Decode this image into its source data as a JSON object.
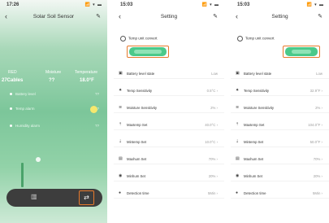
{
  "screen1": {
    "status_time": "17:26",
    "status_icons": "📶 ▾ ▬",
    "title": "Solar Soil Sensor",
    "back_icon": "‹",
    "edit_icon": "✎",
    "stats": [
      {
        "label": "RED",
        "value": "??"
      },
      {
        "label": "Moisture",
        "value": "??"
      },
      {
        "label": "Temperature",
        "value": "??"
      }
    ],
    "stat_main": "27Cables",
    "stat_mid": "??",
    "stat_right": "18.0°F",
    "features": [
      {
        "label": "Battery level",
        "value": "??"
      },
      {
        "label": "Temp alarm",
        "value": "??"
      },
      {
        "label": "Humidity alarm",
        "value": "??"
      }
    ],
    "dock": {
      "chart_icon": "▥",
      "settings_icon": "⇄"
    }
  },
  "screen2": {
    "status_time": "15:03",
    "status_icons": "📶 ▾ ▬",
    "title": "Setting",
    "back_icon": "‹",
    "edit_icon": "✎",
    "unit_label": "Temp unit convert",
    "rows": [
      {
        "icon": "▣",
        "label": "Battery level state",
        "value": "Low"
      },
      {
        "icon": "✷",
        "label": "Temp Sensitivity",
        "value": "0.5°C ›"
      },
      {
        "icon": "≋",
        "label": "Moisture Sensitivity",
        "value": "2% ›"
      },
      {
        "icon": "⇡",
        "label": "Maxtemp Set",
        "value": "40.0°C ›"
      },
      {
        "icon": "⇣",
        "label": "Mintemp Set",
        "value": "10.0°C ›"
      },
      {
        "icon": "▤",
        "label": "Maxhum Set",
        "value": "70% ›"
      },
      {
        "icon": "◉",
        "label": "Minhum Set",
        "value": "20% ›"
      },
      {
        "icon": "●",
        "label": "Detection time",
        "value": "5Min ›"
      }
    ]
  },
  "screen3": {
    "status_time": "15:03",
    "status_icons": "📶 ▾ ▬",
    "title": "Setting",
    "back_icon": "‹",
    "edit_icon": "✎",
    "unit_label": "Temp unit convert",
    "rows": [
      {
        "icon": "▣",
        "label": "Battery level state",
        "value": "Low"
      },
      {
        "icon": "✷",
        "label": "Temp Sensitivity",
        "value": "32.9°F ›"
      },
      {
        "icon": "≋",
        "label": "Moisture Sensitivity",
        "value": "2% ›"
      },
      {
        "icon": "⇡",
        "label": "Maxtemp Set",
        "value": "104.0°F ›"
      },
      {
        "icon": "⇣",
        "label": "Mintemp Set",
        "value": "50.0°F ›"
      },
      {
        "icon": "▤",
        "label": "Maxhum Set",
        "value": "70% ›"
      },
      {
        "icon": "◉",
        "label": "Minhum Set",
        "value": "20% ›"
      },
      {
        "icon": "●",
        "label": "Detection time",
        "value": "5Min ›"
      }
    ]
  }
}
